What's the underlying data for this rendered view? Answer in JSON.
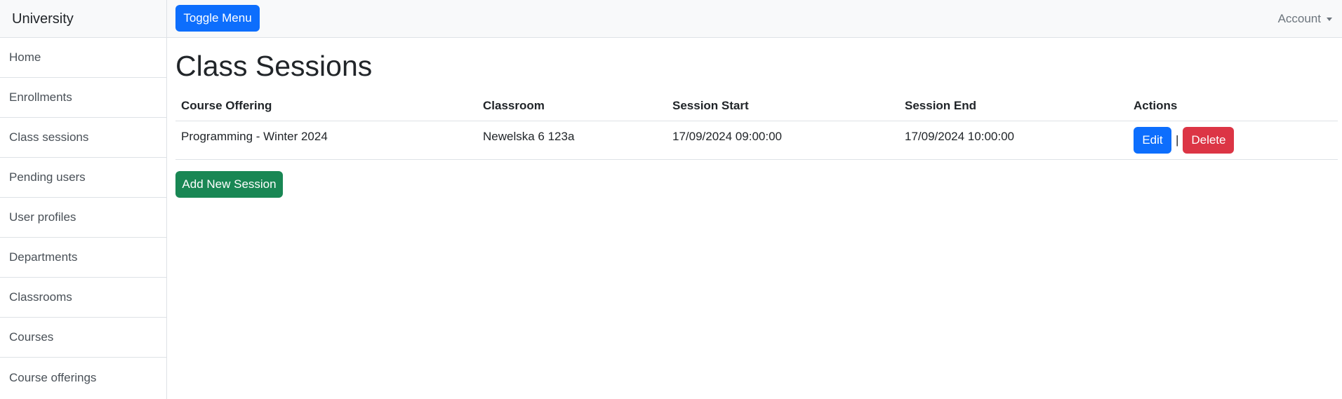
{
  "sidebar": {
    "brand": "University",
    "items": [
      {
        "label": "Home"
      },
      {
        "label": "Enrollments"
      },
      {
        "label": "Class sessions"
      },
      {
        "label": "Pending users"
      },
      {
        "label": "User profiles"
      },
      {
        "label": "Departments"
      },
      {
        "label": "Classrooms"
      },
      {
        "label": "Courses"
      },
      {
        "label": "Course offerings"
      }
    ]
  },
  "topbar": {
    "toggle_label": "Toggle Menu",
    "account_label": "Account"
  },
  "main": {
    "title": "Class Sessions",
    "table": {
      "headers": [
        "Course Offering",
        "Classroom",
        "Session Start",
        "Session End",
        "Actions"
      ],
      "rows": [
        {
          "course_offering": "Programming - Winter 2024",
          "classroom": "Newelska 6 123a",
          "session_start": "17/09/2024 09:00:00",
          "session_end": "17/09/2024 10:00:00",
          "edit_label": "Edit",
          "separator": "|",
          "delete_label": "Delete"
        }
      ]
    },
    "add_button_label": "Add New Session"
  },
  "colors": {
    "primary": "#0d6efd",
    "success": "#198754",
    "danger": "#dc3545"
  }
}
